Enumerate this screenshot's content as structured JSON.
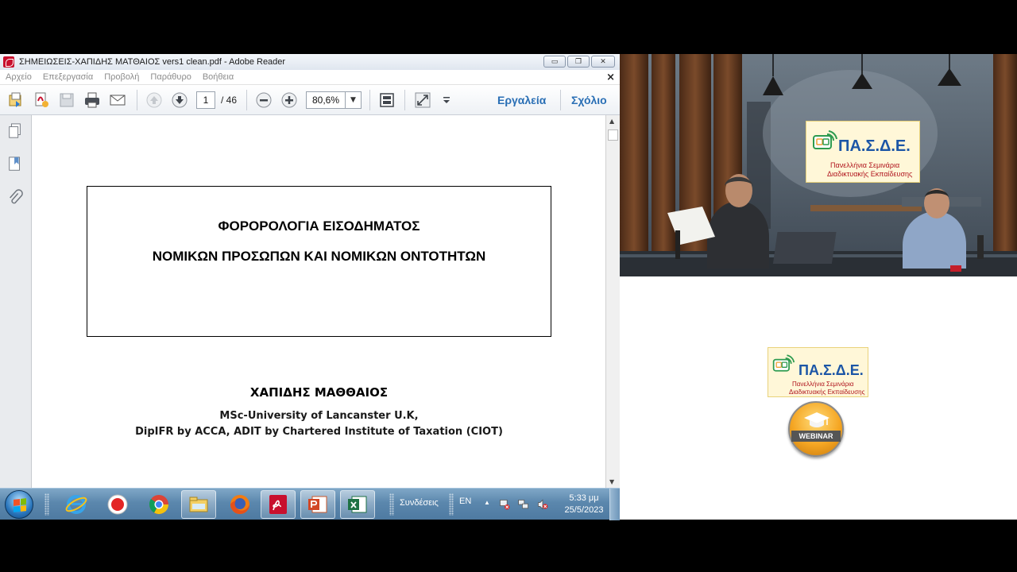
{
  "window": {
    "title": "ΣΗΜΕΙΩΣΕΙΣ-ΧΑΠΙΔΗΣ ΜΑΤΘΑΙΟΣ vers1 clean.pdf - Adobe Reader",
    "minimize": "▭",
    "maximize": "❐",
    "close": "✕"
  },
  "menu": {
    "items": [
      "Αρχείο",
      "Επεξεργασία",
      "Προβολή",
      "Παράθυρο",
      "Βοήθεια"
    ],
    "close": "×"
  },
  "toolbar": {
    "page_current": "1",
    "page_total": "/ 46",
    "zoom": "80,6%",
    "zoom_dropdown": "▼",
    "tools_label": "Εργαλεία",
    "comment_label": "Σχόλιο"
  },
  "document": {
    "title_line1": "ΦΟΡΟΡΟΛΟΓΙΑ ΕΙΣΟΔΗΜΑΤΟΣ",
    "title_line2": "ΝΟΜΙΚΩΝ ΠΡΟΣΩΠΩΝ ΚΑΙ ΝΟΜΙΚΩΝ ΟΝΤΟΤΗΤΩΝ",
    "author": "ΧΑΠΙΔΗΣ ΜΑΘΘΑΙΟΣ",
    "credentials_line1": "MSc-University of Lancanster U.K,",
    "credentials_line2": "DipIFR by ACCA,   ADIT by Chartered Institute of Taxation (CIOT)"
  },
  "scrollbar": {
    "up": "▲",
    "down": "▼"
  },
  "taskbar": {
    "toolbar_label": "Συνδέσεις",
    "language": "EN",
    "tray_arrow": "▲",
    "time": "5:33 μμ",
    "date": "25/5/2023"
  },
  "logos": {
    "video_logo": {
      "title": "ΠΑ.Σ.Δ.Ε.",
      "line1": "Πανελλήνια Σεμινάρια",
      "line2": "Διαδικτυακής Εκπαίδευσης"
    },
    "panel_logo": {
      "title": "ΠΑ.Σ.Δ.Ε.",
      "line1": "Πανελλήνια Σεμινάρια",
      "line2": "Διαδικτυακής Εκπαίδευσης"
    },
    "webinar": "WEBINAR"
  },
  "colors": {
    "accent_blue": "#2a6fb5",
    "taskbar": "#5b87ad",
    "logo_blue": "#1c56a6",
    "logo_red": "#b0151e"
  }
}
